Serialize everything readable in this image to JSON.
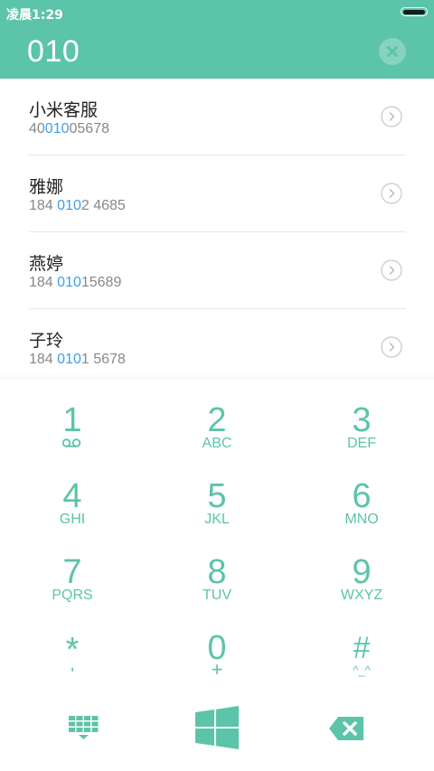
{
  "status": {
    "time": "凌晨1:29"
  },
  "search": {
    "query": "010"
  },
  "contacts": [
    {
      "name": "小米客服",
      "num_before": "40",
      "num_match": "010",
      "num_after": "05678"
    },
    {
      "name": "雅娜",
      "num_before": "184 ",
      "num_match": "010",
      "num_after": "2 4685"
    },
    {
      "name": "燕婷",
      "num_before": "184 ",
      "num_match": "010",
      "num_after": "15689"
    },
    {
      "name": "子玲",
      "num_before": "184 ",
      "num_match": "010",
      "num_after": "1 5678"
    }
  ],
  "keys": [
    {
      "digit": "1",
      "letters": ""
    },
    {
      "digit": "2",
      "letters": "ABC"
    },
    {
      "digit": "3",
      "letters": "DEF"
    },
    {
      "digit": "4",
      "letters": "GHI"
    },
    {
      "digit": "5",
      "letters": "JKL"
    },
    {
      "digit": "6",
      "letters": "MNO"
    },
    {
      "digit": "7",
      "letters": "PQRS"
    },
    {
      "digit": "8",
      "letters": "TUV"
    },
    {
      "digit": "9",
      "letters": "WXYZ"
    },
    {
      "digit": "*",
      "letters": ","
    },
    {
      "digit": "0",
      "letters": "+"
    },
    {
      "digit": "#",
      "letters": "^_^"
    }
  ],
  "colors": {
    "accent": "#5cc4a8",
    "match": "#3f9ee8"
  },
  "icons": {
    "voicemail": "voicemail-icon",
    "clear": "close-icon",
    "detail": "chevron-right-icon",
    "dialpad_toggle": "dialpad-icon",
    "call": "windows-logo-icon",
    "backspace": "backspace-icon"
  }
}
